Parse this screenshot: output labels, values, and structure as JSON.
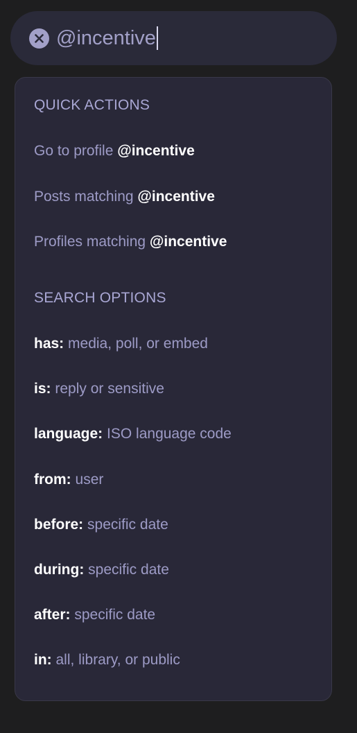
{
  "search": {
    "value": "@incentive"
  },
  "quick_actions": {
    "heading": "QUICK ACTIONS",
    "items": [
      {
        "prefix": "Go to profile ",
        "term": "@incentive"
      },
      {
        "prefix": "Posts matching ",
        "term": "@incentive"
      },
      {
        "prefix": "Profiles matching ",
        "term": "@incentive"
      }
    ]
  },
  "search_options": {
    "heading": "SEARCH OPTIONS",
    "items": [
      {
        "key": "has:",
        "hint": "media, poll, or embed"
      },
      {
        "key": "is:",
        "hint": "reply or sensitive"
      },
      {
        "key": "language:",
        "hint": "ISO language code"
      },
      {
        "key": "from:",
        "hint": "user"
      },
      {
        "key": "before:",
        "hint": "specific date"
      },
      {
        "key": "during:",
        "hint": "specific date"
      },
      {
        "key": "after:",
        "hint": "specific date"
      },
      {
        "key": "in:",
        "hint": "all, library, or public"
      }
    ]
  },
  "icons": {
    "clear": "close-circle-icon"
  },
  "colors": {
    "background": "#1e1e1f",
    "surface": "#292838",
    "accent": "#a2a0c8",
    "text_strong": "#ffffff"
  }
}
